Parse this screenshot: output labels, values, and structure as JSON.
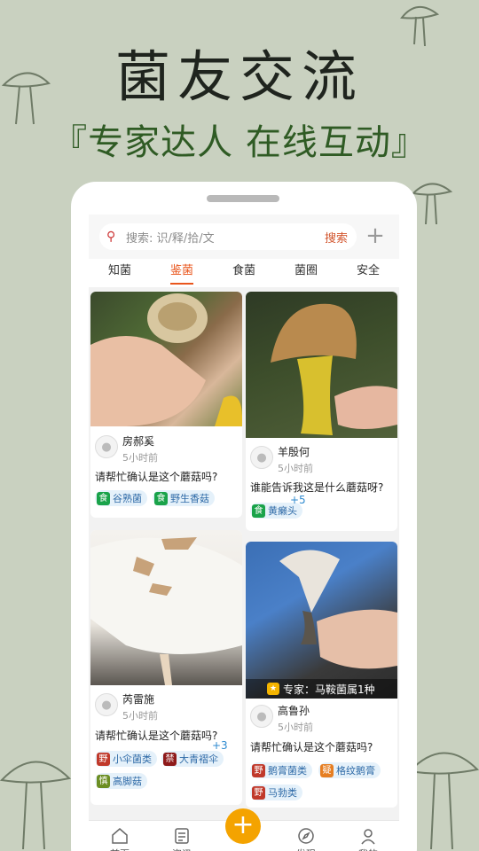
{
  "banner": {
    "title": "菌友交流",
    "subtitle": "『专家达人 在线互动』"
  },
  "search": {
    "placeholder": "搜索: 识/释/拾/文",
    "button": "搜索"
  },
  "tabs": [
    "知菌",
    "鉴菌",
    "食菌",
    "菌圈",
    "安全"
  ],
  "active_tab": "鉴菌",
  "posts": [
    {
      "user": "房郝奚",
      "time": "5小时前",
      "question": "请帮忙确认是这个蘑菇吗?",
      "tags": [
        {
          "icon": "食",
          "label": "谷熟菌",
          "color": "#1aa34a"
        },
        {
          "icon": "食",
          "label": "野生香菇",
          "color": "#1aa34a"
        }
      ]
    },
    {
      "user": "羊殷何",
      "time": "5小时前",
      "question": "谁能告诉我这是什么蘑菇呀?",
      "tags": [
        {
          "icon": "食",
          "label": "黄癞头",
          "color": "#1aa34a"
        }
      ],
      "more": "+5"
    },
    {
      "user": "芮雷施",
      "time": "5小时前",
      "question": "请帮忙确认是这个蘑菇吗?",
      "tags": [
        {
          "icon": "野",
          "label": "小伞菌类",
          "color": "#c0392b"
        },
        {
          "icon": "禁",
          "label": "大青褶伞",
          "color": "#8e1a1a"
        },
        {
          "icon": "慎",
          "label": "高脚菇",
          "color": "#6b8e23"
        }
      ],
      "more": "+3"
    },
    {
      "user": "高鲁孙",
      "time": "5小时前",
      "question": "请帮忙确认是这个蘑菇吗?",
      "expert": "专家：马鞍菌属1种",
      "tags": [
        {
          "icon": "野",
          "label": "鹅膏菌类",
          "color": "#c0392b"
        },
        {
          "icon": "疑",
          "label": "格纹鹅膏",
          "color": "#e67e22"
        },
        {
          "icon": "野",
          "label": "马勃类",
          "color": "#c0392b"
        }
      ]
    }
  ],
  "nav": [
    "首页",
    "资讯",
    "发布",
    "发现",
    "我的"
  ],
  "colors": {
    "accent": "#e9561d",
    "fab": "#f4a300",
    "background": "#c9d1c0",
    "subtitle": "#2f5b24"
  }
}
